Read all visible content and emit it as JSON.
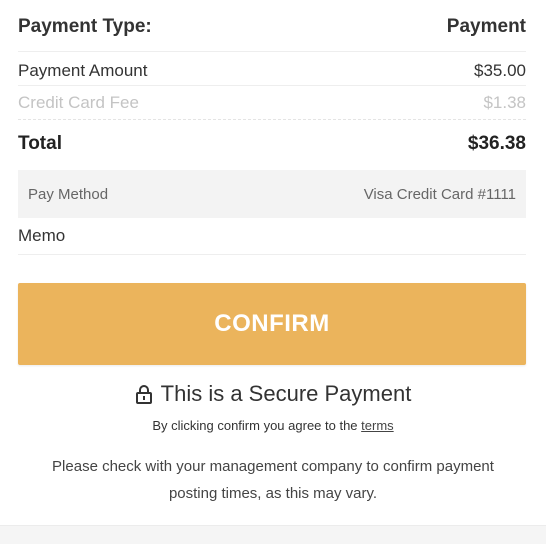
{
  "payment_type": {
    "label": "Payment Type:",
    "value": "Payment"
  },
  "amount": {
    "label": "Payment Amount",
    "value": "$35.00"
  },
  "fee": {
    "label": "Credit Card Fee",
    "value": "$1.38"
  },
  "total": {
    "label": "Total",
    "value": "$36.38"
  },
  "pay_method": {
    "label": "Pay Method",
    "value": "Visa Credit Card #1111"
  },
  "memo": {
    "label": "Memo"
  },
  "confirm_button": {
    "label": "CONFIRM",
    "color": "#ebb45c"
  },
  "secure": {
    "icon": "lock-icon",
    "text": "This is a Secure Payment"
  },
  "agreement": {
    "prefix": "By clicking confirm you agree to the ",
    "link": "terms"
  },
  "note": "Please check with your management company to confirm payment posting times, as this may vary."
}
